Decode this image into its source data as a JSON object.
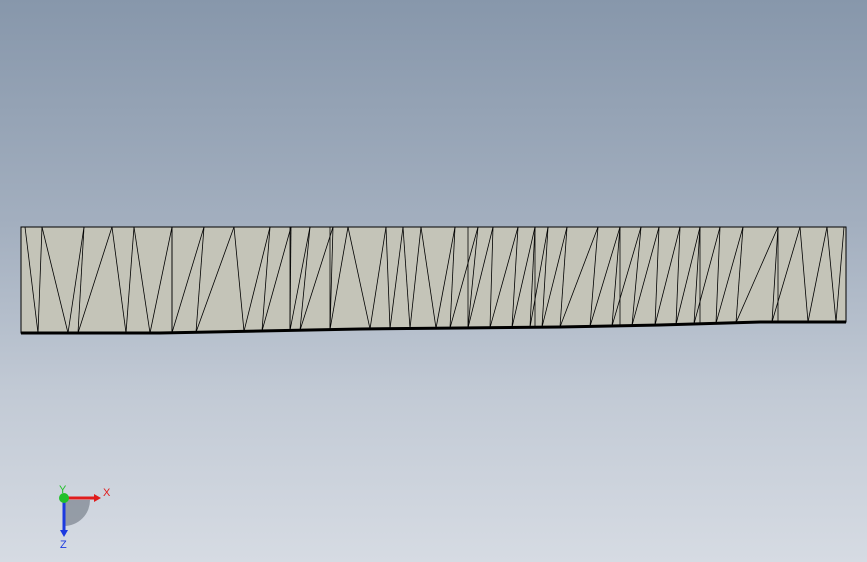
{
  "viewport": {
    "background_top": "#8797ab",
    "background_bottom": "#d6dbe3"
  },
  "model": {
    "face_color": "#c4c4b8",
    "edge_color": "#000000"
  },
  "triad": {
    "x_label": "X",
    "y_label": "Y",
    "z_label": "Z",
    "x_color": "#e01c1c",
    "y_color": "#22c02a",
    "z_color": "#1c3ae0"
  }
}
